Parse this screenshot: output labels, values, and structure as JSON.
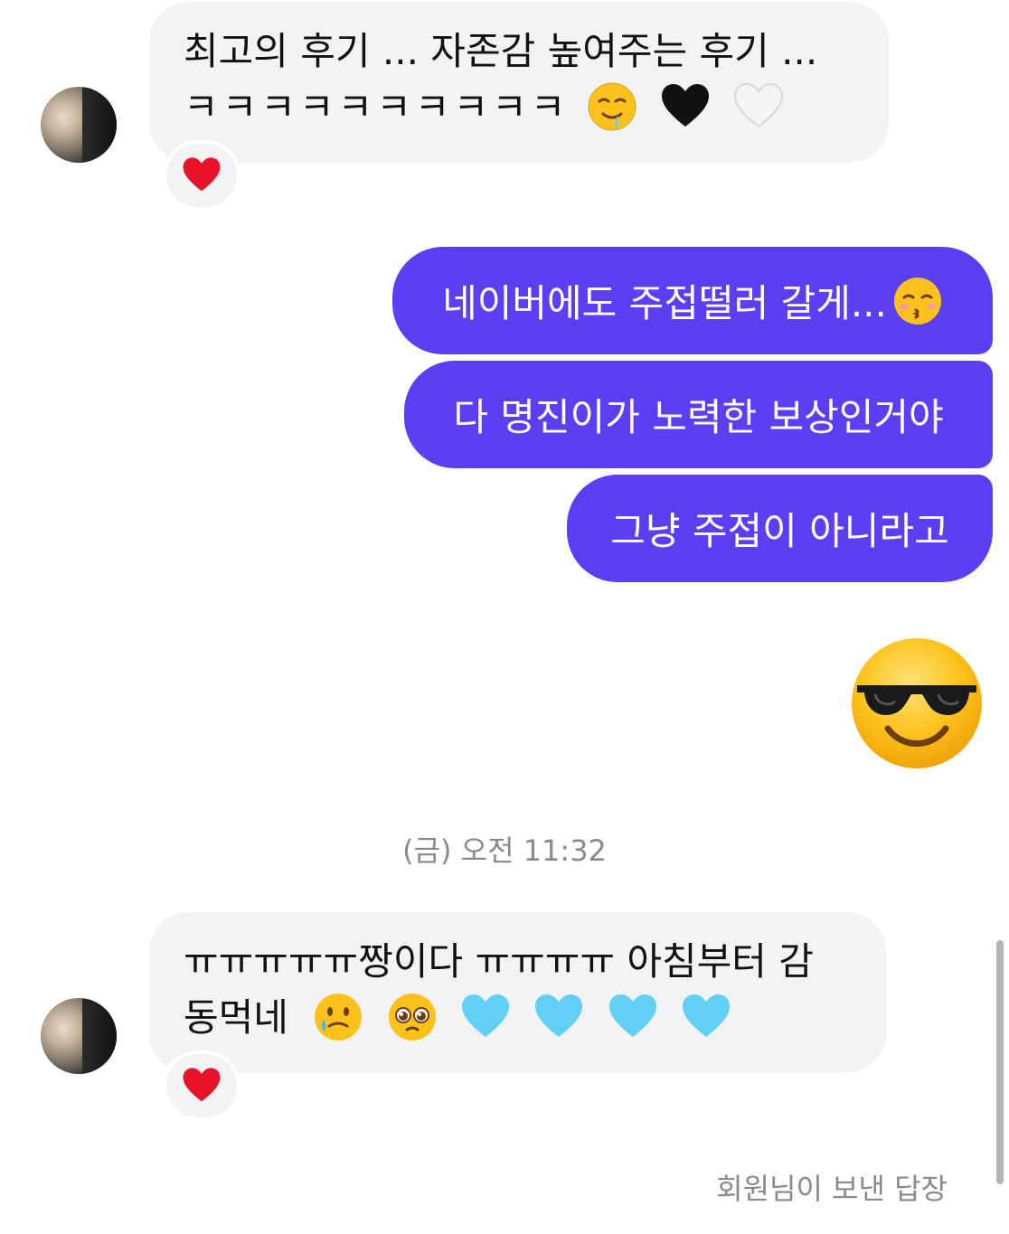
{
  "messages": {
    "first_incoming": {
      "line1": "최고의 후기 ... 자존감 높여주는 후기 ...",
      "line2": "ㅋㅋㅋㅋㅋㅋㅋㅋㅋㅋ",
      "emojis": [
        "drooling-face",
        "black-heart",
        "white-heart"
      ],
      "reaction": "red-heart"
    },
    "outgoing": [
      {
        "text": "네이버에도 주접떨러 갈게...",
        "emoji": "kissing-face-closed-eyes"
      },
      {
        "text": "다 명진이가 노력한 보상인거야"
      },
      {
        "text": "그냥 주접이 아니라고"
      }
    ],
    "big_emoji": "sunglasses-face",
    "timestamp": "(금) 오전 11:32",
    "second_incoming": {
      "line1": "ㅠㅠㅠㅠㅠ짱이다 ㅠㅠㅠㅠ 아침부터 감",
      "line2": "동먹네",
      "emojis": [
        "tear-smile-face",
        "pleading-face",
        "light-blue-heart",
        "light-blue-heart",
        "light-blue-heart",
        "light-blue-heart"
      ],
      "reaction": "red-heart"
    },
    "footer": "회원님이 보낸 답장"
  },
  "colors": {
    "outgoing_bubble": "#5b3ff4",
    "incoming_bubble": "#f2f3f5",
    "meta_text": "#8a8a8a"
  }
}
